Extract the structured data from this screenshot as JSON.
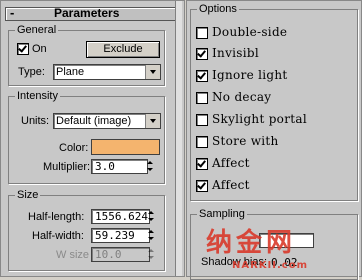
{
  "left_panel": {
    "rollout_sign": "-",
    "rollout_title": "Parameters",
    "general": {
      "title": "General",
      "on_label": "On",
      "on_checked": true,
      "exclude_label": "Exclude",
      "type_label": "Type:",
      "type_value": "Plane"
    },
    "intensity": {
      "title": "Intensity",
      "units_label": "Units:",
      "units_value": "Default (image)",
      "color_label": "Color:",
      "color_value": "#f4b46e",
      "multiplier_label": "Multiplier:",
      "multiplier_value": "3.0"
    },
    "size": {
      "title": "Size",
      "half_length_label": "Half-length:",
      "half_length_value": "1556.624",
      "half_width_label": "Half-width:",
      "half_width_value": "59.239",
      "w_size_label": "W size",
      "w_size_value": "10.0"
    }
  },
  "right_panel": {
    "options": {
      "title": "Options",
      "items": [
        {
          "label": "Double-side",
          "checked": false
        },
        {
          "label": "Invisibl",
          "checked": true
        },
        {
          "label": "Ignore light",
          "checked": true
        },
        {
          "label": "No decay",
          "checked": false
        },
        {
          "label": "Skylight portal",
          "checked": false
        },
        {
          "label": "Store with",
          "checked": false
        },
        {
          "label": "Affect",
          "checked": true
        },
        {
          "label": "Affect",
          "checked": true
        }
      ]
    },
    "sampling": {
      "title": "Sampling",
      "shadow_bias_label": "Shadow bias:",
      "shadow_bias_value": "0.02"
    }
  },
  "watermark": {
    "text": "纳金网",
    "url": "NARKII.com"
  }
}
